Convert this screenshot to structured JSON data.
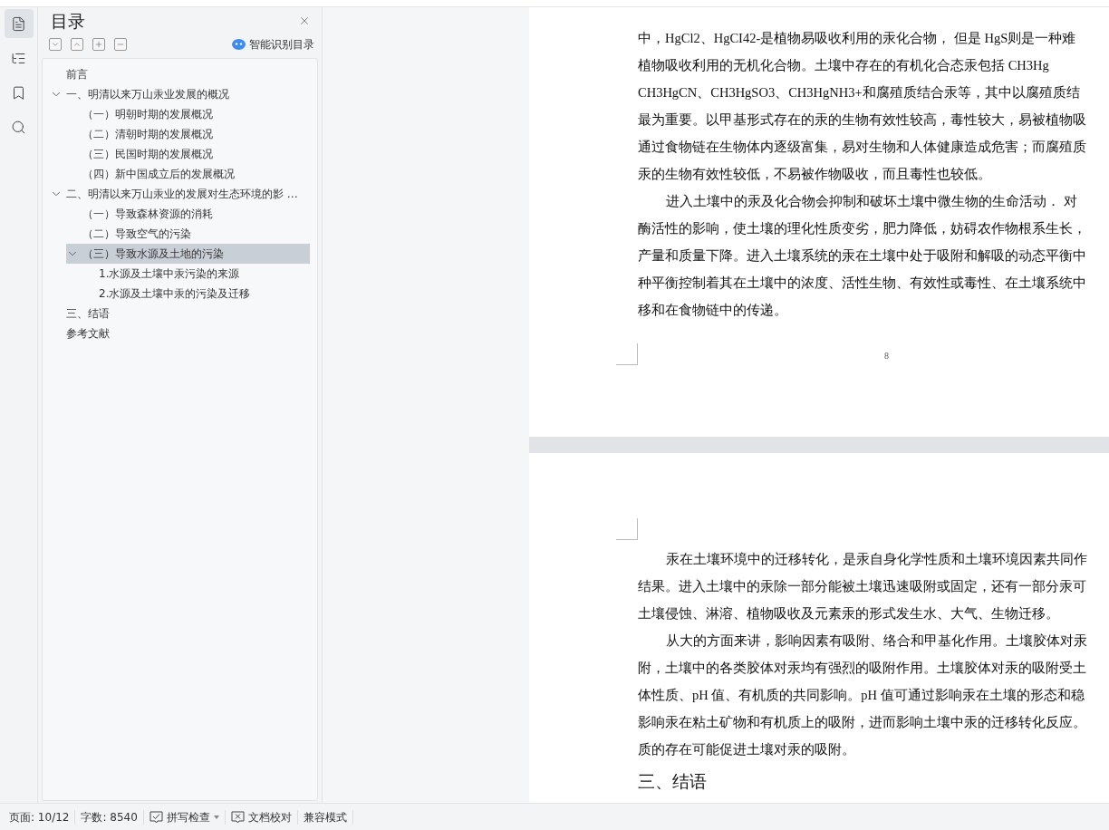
{
  "rail": [
    {
      "kind": "toc",
      "selected": true
    },
    {
      "kind": "outline",
      "selected": false
    },
    {
      "kind": "bookmark",
      "selected": false
    },
    {
      "kind": "search",
      "selected": false
    }
  ],
  "panel": {
    "title": "目录",
    "toolbar": [
      {
        "kind": "collapse"
      },
      {
        "kind": "expand"
      },
      {
        "kind": "add"
      },
      {
        "kind": "remove"
      }
    ],
    "smart_button": "智能识别目录",
    "tree": [
      {
        "label": "前言",
        "selected": false
      },
      {
        "label": "一、明清以来万山汞业发展的概况",
        "selected": false,
        "expanded": true,
        "children": [
          {
            "label": "（一）明朝时期的发展概况",
            "selected": false
          },
          {
            "label": "（二）清朝时期的发展概况",
            "selected": false
          },
          {
            "label": "（三）民国时期的发展概况",
            "selected": false
          },
          {
            "label": "（四）新中国成立后的发展概况",
            "selected": false
          }
        ]
      },
      {
        "label": "二、明清以来万山汞业的发展对生态环境的影 …",
        "selected": false,
        "expanded": true,
        "children": [
          {
            "label": "（一）导致森林资源的消耗",
            "selected": false
          },
          {
            "label": "（二）导致空气的污染",
            "selected": false
          },
          {
            "label": "（三）导致水源及土地的污染",
            "selected": true,
            "expanded": true,
            "children": [
              {
                "label": "1.水源及土壤中汞污染的来源",
                "selected": false
              },
              {
                "label": "2.水源及土壤中汞的污染及迁移",
                "selected": false
              }
            ]
          }
        ]
      },
      {
        "label": "三、结语",
        "selected": false
      },
      {
        "label": "参考文献",
        "selected": false
      }
    ]
  },
  "document": {
    "pages": [
      {
        "page_number": "8",
        "blocks": [
          {
            "kind": "continuation",
            "lines": [
              "中，HgCl2、HgCI42-是植物易吸收利用的汞化合物， 但是 HgS则是一种难",
              "植物吸收利用的无机化合物。土壤中存在的有机化合态汞包括 CH3Hg",
              "CH3HgCN、CH3HgSO3、CH3HgNH3+和腐殖质结合汞等，其中以腐殖质结",
              "最为重要。以甲基形式存在的汞的生物有效性较高，毒性较大，易被植物吸",
              "通过食物链在生物体内逐级富集，易对生物和人体健康造成危害；而腐殖质",
              "汞的生物有效性较低，不易被作物吸收，而且毒性也较低。"
            ]
          },
          {
            "kind": "paragraph",
            "lines": [
              "进入土壤中的汞及化合物会抑制和破坏土壤中微生物的生命活动．  对",
              "酶活性的影响，使土壤的理化性质变劣，肥力降低，妨碍农作物根系生长，",
              "产量和质量下降。进入土壤系统的汞在土壤中处于吸附和解吸的动态平衡中",
              "种平衡控制着其在土壤中的浓度、活性生物、有效性或毒性、在土壤系统中",
              "移和在食物链中的传递。"
            ]
          }
        ]
      },
      {
        "blocks": [
          {
            "kind": "paragraph",
            "lines": [
              "汞在土壤环境中的迁移转化，是汞自身化学性质和土壤环境因素共同作",
              "结果。进入土壤中的汞除一部分能被土壤迅速吸附或固定，还有一部分汞可",
              "土壤侵蚀、淋溶、植物吸收及元素汞的形式发生水、大气、生物迁移。"
            ]
          },
          {
            "kind": "paragraph",
            "lines": [
              "从大的方面来讲，影响因素有吸附、络合和甲基化作用。土壤胶体对汞",
              "附，土壤中的各类胶体对汞均有强烈的吸附作用。土壤胶体对汞的吸附受土",
              "体性质、pH 值、有机质的共同影响。pH 值可通过影响汞在土壤的形态和稳",
              "影响汞在粘土矿物和有机质上的吸附，进而影响土壤中汞的迁移转化反应。",
              "质的存在可能促进土壤对汞的吸附。"
            ]
          },
          {
            "kind": "heading",
            "lines": [
              "三、结语"
            ]
          }
        ]
      }
    ]
  },
  "status_bar": [
    {
      "kind": "text",
      "label": "页面: 10/12"
    },
    {
      "kind": "text",
      "label": "字数: 8540"
    },
    {
      "kind": "spellcheck",
      "label": "拼写检查"
    },
    {
      "kind": "proofread",
      "label": "文档校对"
    },
    {
      "kind": "text",
      "label": "兼容模式"
    }
  ]
}
